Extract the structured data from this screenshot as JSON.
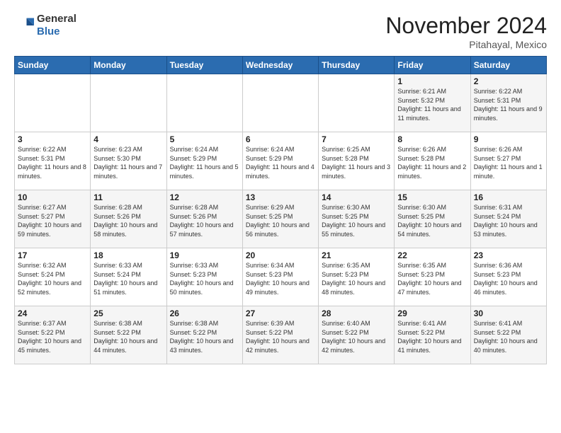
{
  "header": {
    "logo": {
      "general": "General",
      "blue": "Blue"
    },
    "title": "November 2024",
    "subtitle": "Pitahayal, Mexico"
  },
  "calendar": {
    "weekdays": [
      "Sunday",
      "Monday",
      "Tuesday",
      "Wednesday",
      "Thursday",
      "Friday",
      "Saturday"
    ],
    "weeks": [
      [
        {
          "day": "",
          "info": ""
        },
        {
          "day": "",
          "info": ""
        },
        {
          "day": "",
          "info": ""
        },
        {
          "day": "",
          "info": ""
        },
        {
          "day": "",
          "info": ""
        },
        {
          "day": "1",
          "info": "Sunrise: 6:21 AM\nSunset: 5:32 PM\nDaylight: 11 hours and 11 minutes."
        },
        {
          "day": "2",
          "info": "Sunrise: 6:22 AM\nSunset: 5:31 PM\nDaylight: 11 hours and 9 minutes."
        }
      ],
      [
        {
          "day": "3",
          "info": "Sunrise: 6:22 AM\nSunset: 5:31 PM\nDaylight: 11 hours and 8 minutes."
        },
        {
          "day": "4",
          "info": "Sunrise: 6:23 AM\nSunset: 5:30 PM\nDaylight: 11 hours and 7 minutes."
        },
        {
          "day": "5",
          "info": "Sunrise: 6:24 AM\nSunset: 5:29 PM\nDaylight: 11 hours and 5 minutes."
        },
        {
          "day": "6",
          "info": "Sunrise: 6:24 AM\nSunset: 5:29 PM\nDaylight: 11 hours and 4 minutes."
        },
        {
          "day": "7",
          "info": "Sunrise: 6:25 AM\nSunset: 5:28 PM\nDaylight: 11 hours and 3 minutes."
        },
        {
          "day": "8",
          "info": "Sunrise: 6:26 AM\nSunset: 5:28 PM\nDaylight: 11 hours and 2 minutes."
        },
        {
          "day": "9",
          "info": "Sunrise: 6:26 AM\nSunset: 5:27 PM\nDaylight: 11 hours and 1 minute."
        }
      ],
      [
        {
          "day": "10",
          "info": "Sunrise: 6:27 AM\nSunset: 5:27 PM\nDaylight: 10 hours and 59 minutes."
        },
        {
          "day": "11",
          "info": "Sunrise: 6:28 AM\nSunset: 5:26 PM\nDaylight: 10 hours and 58 minutes."
        },
        {
          "day": "12",
          "info": "Sunrise: 6:28 AM\nSunset: 5:26 PM\nDaylight: 10 hours and 57 minutes."
        },
        {
          "day": "13",
          "info": "Sunrise: 6:29 AM\nSunset: 5:25 PM\nDaylight: 10 hours and 56 minutes."
        },
        {
          "day": "14",
          "info": "Sunrise: 6:30 AM\nSunset: 5:25 PM\nDaylight: 10 hours and 55 minutes."
        },
        {
          "day": "15",
          "info": "Sunrise: 6:30 AM\nSunset: 5:25 PM\nDaylight: 10 hours and 54 minutes."
        },
        {
          "day": "16",
          "info": "Sunrise: 6:31 AM\nSunset: 5:24 PM\nDaylight: 10 hours and 53 minutes."
        }
      ],
      [
        {
          "day": "17",
          "info": "Sunrise: 6:32 AM\nSunset: 5:24 PM\nDaylight: 10 hours and 52 minutes."
        },
        {
          "day": "18",
          "info": "Sunrise: 6:33 AM\nSunset: 5:24 PM\nDaylight: 10 hours and 51 minutes."
        },
        {
          "day": "19",
          "info": "Sunrise: 6:33 AM\nSunset: 5:23 PM\nDaylight: 10 hours and 50 minutes."
        },
        {
          "day": "20",
          "info": "Sunrise: 6:34 AM\nSunset: 5:23 PM\nDaylight: 10 hours and 49 minutes."
        },
        {
          "day": "21",
          "info": "Sunrise: 6:35 AM\nSunset: 5:23 PM\nDaylight: 10 hours and 48 minutes."
        },
        {
          "day": "22",
          "info": "Sunrise: 6:35 AM\nSunset: 5:23 PM\nDaylight: 10 hours and 47 minutes."
        },
        {
          "day": "23",
          "info": "Sunrise: 6:36 AM\nSunset: 5:23 PM\nDaylight: 10 hours and 46 minutes."
        }
      ],
      [
        {
          "day": "24",
          "info": "Sunrise: 6:37 AM\nSunset: 5:22 PM\nDaylight: 10 hours and 45 minutes."
        },
        {
          "day": "25",
          "info": "Sunrise: 6:38 AM\nSunset: 5:22 PM\nDaylight: 10 hours and 44 minutes."
        },
        {
          "day": "26",
          "info": "Sunrise: 6:38 AM\nSunset: 5:22 PM\nDaylight: 10 hours and 43 minutes."
        },
        {
          "day": "27",
          "info": "Sunrise: 6:39 AM\nSunset: 5:22 PM\nDaylight: 10 hours and 42 minutes."
        },
        {
          "day": "28",
          "info": "Sunrise: 6:40 AM\nSunset: 5:22 PM\nDaylight: 10 hours and 42 minutes."
        },
        {
          "day": "29",
          "info": "Sunrise: 6:41 AM\nSunset: 5:22 PM\nDaylight: 10 hours and 41 minutes."
        },
        {
          "day": "30",
          "info": "Sunrise: 6:41 AM\nSunset: 5:22 PM\nDaylight: 10 hours and 40 minutes."
        }
      ]
    ]
  }
}
